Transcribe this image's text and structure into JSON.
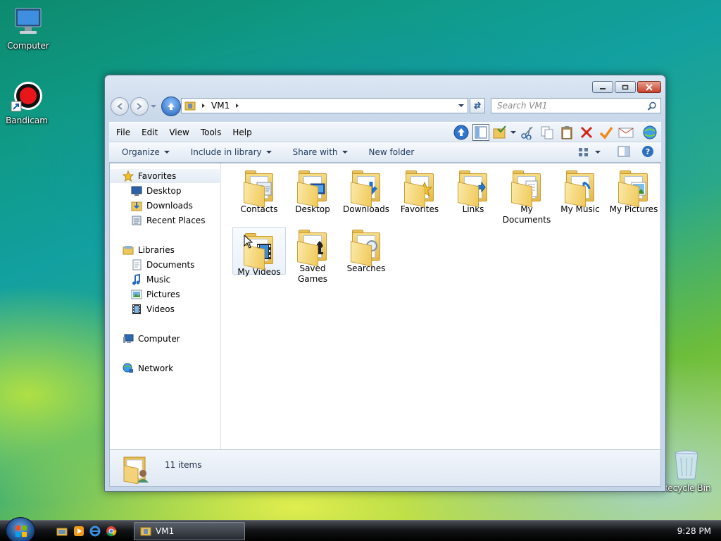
{
  "desktop": {
    "icons": [
      {
        "label": "Computer"
      },
      {
        "label": "Bandicam"
      },
      {
        "label": "Recycle Bin"
      }
    ]
  },
  "window": {
    "address": {
      "path": "VM1"
    },
    "search": {
      "placeholder": "Search VM1"
    },
    "menu": [
      "File",
      "Edit",
      "View",
      "Tools",
      "Help"
    ],
    "commands": {
      "organize": "Organize",
      "include_library": "Include in library",
      "share_with": "Share with",
      "new_folder": "New folder"
    },
    "nav": {
      "favorites": "Favorites",
      "desktop": "Desktop",
      "downloads": "Downloads",
      "recent_places": "Recent Places",
      "libraries": "Libraries",
      "documents": "Documents",
      "music": "Music",
      "pictures": "Pictures",
      "videos": "Videos",
      "computer": "Computer",
      "network": "Network"
    },
    "files": [
      {
        "label": "Contacts"
      },
      {
        "label": "Desktop"
      },
      {
        "label": "Downloads"
      },
      {
        "label": "Favorites"
      },
      {
        "label": "Links"
      },
      {
        "label": "My Documents"
      },
      {
        "label": "My Music"
      },
      {
        "label": "My Pictures"
      },
      {
        "label": "My Videos"
      },
      {
        "label": "Saved Games"
      },
      {
        "label": "Searches"
      }
    ],
    "status": {
      "item_count": "11 items"
    }
  },
  "taskbar": {
    "task_label": "VM1",
    "clock": "9:28 PM"
  }
}
